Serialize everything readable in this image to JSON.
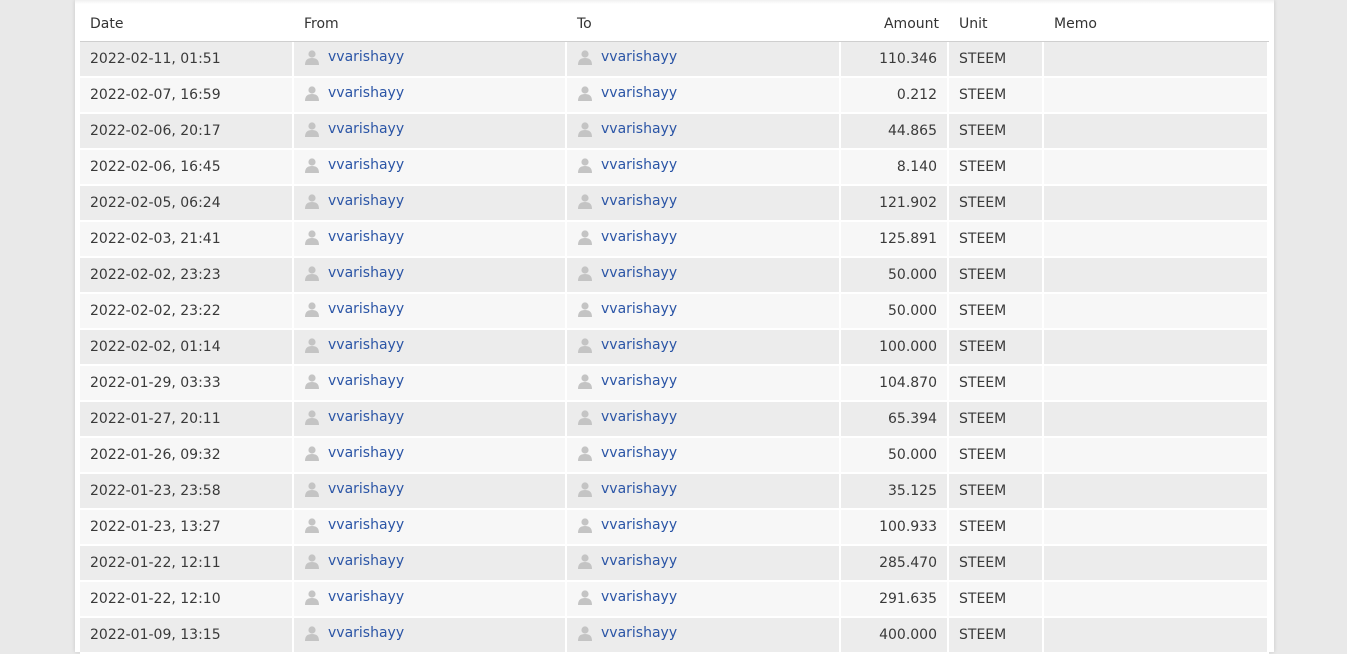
{
  "table": {
    "headers": {
      "date": "Date",
      "from": "From",
      "to": "To",
      "amount": "Amount",
      "unit": "Unit",
      "memo": "Memo"
    },
    "rows": [
      {
        "date": "2022-02-11, 01:51",
        "from": "vvarishayy",
        "to": "vvarishayy",
        "amount": "110.346",
        "unit": "STEEM",
        "memo": ""
      },
      {
        "date": "2022-02-07, 16:59",
        "from": "vvarishayy",
        "to": "vvarishayy",
        "amount": "0.212",
        "unit": "STEEM",
        "memo": ""
      },
      {
        "date": "2022-02-06, 20:17",
        "from": "vvarishayy",
        "to": "vvarishayy",
        "amount": "44.865",
        "unit": "STEEM",
        "memo": ""
      },
      {
        "date": "2022-02-06, 16:45",
        "from": "vvarishayy",
        "to": "vvarishayy",
        "amount": "8.140",
        "unit": "STEEM",
        "memo": ""
      },
      {
        "date": "2022-02-05, 06:24",
        "from": "vvarishayy",
        "to": "vvarishayy",
        "amount": "121.902",
        "unit": "STEEM",
        "memo": ""
      },
      {
        "date": "2022-02-03, 21:41",
        "from": "vvarishayy",
        "to": "vvarishayy",
        "amount": "125.891",
        "unit": "STEEM",
        "memo": ""
      },
      {
        "date": "2022-02-02, 23:23",
        "from": "vvarishayy",
        "to": "vvarishayy",
        "amount": "50.000",
        "unit": "STEEM",
        "memo": ""
      },
      {
        "date": "2022-02-02, 23:22",
        "from": "vvarishayy",
        "to": "vvarishayy",
        "amount": "50.000",
        "unit": "STEEM",
        "memo": ""
      },
      {
        "date": "2022-02-02, 01:14",
        "from": "vvarishayy",
        "to": "vvarishayy",
        "amount": "100.000",
        "unit": "STEEM",
        "memo": ""
      },
      {
        "date": "2022-01-29, 03:33",
        "from": "vvarishayy",
        "to": "vvarishayy",
        "amount": "104.870",
        "unit": "STEEM",
        "memo": ""
      },
      {
        "date": "2022-01-27, 20:11",
        "from": "vvarishayy",
        "to": "vvarishayy",
        "amount": "65.394",
        "unit": "STEEM",
        "memo": ""
      },
      {
        "date": "2022-01-26, 09:32",
        "from": "vvarishayy",
        "to": "vvarishayy",
        "amount": "50.000",
        "unit": "STEEM",
        "memo": ""
      },
      {
        "date": "2022-01-23, 23:58",
        "from": "vvarishayy",
        "to": "vvarishayy",
        "amount": "35.125",
        "unit": "STEEM",
        "memo": ""
      },
      {
        "date": "2022-01-23, 13:27",
        "from": "vvarishayy",
        "to": "vvarishayy",
        "amount": "100.933",
        "unit": "STEEM",
        "memo": ""
      },
      {
        "date": "2022-01-22, 12:11",
        "from": "vvarishayy",
        "to": "vvarishayy",
        "amount": "285.470",
        "unit": "STEEM",
        "memo": ""
      },
      {
        "date": "2022-01-22, 12:10",
        "from": "vvarishayy",
        "to": "vvarishayy",
        "amount": "291.635",
        "unit": "STEEM",
        "memo": ""
      },
      {
        "date": "2022-01-09, 13:15",
        "from": "vvarishayy",
        "to": "vvarishayy",
        "amount": "400.000",
        "unit": "STEEM",
        "memo": ""
      }
    ]
  },
  "icons": {
    "user_avatar": "user-avatar-icon"
  },
  "colors": {
    "link": "#2b55a6",
    "row_odd": "#ececec",
    "row_even": "#f7f7f7",
    "page_background": "#e9e9e9"
  }
}
